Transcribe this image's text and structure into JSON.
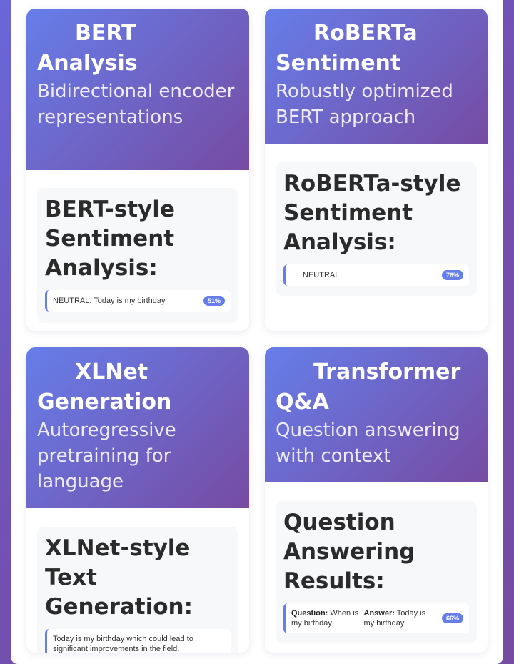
{
  "cards": [
    {
      "title": "BERT Analysis",
      "subtitle": "Bidirectional encoder representations",
      "result_title": "BERT-style Sentiment Analysis:",
      "result_text": "NEUTRAL: Today is my birthday",
      "badge": "51%"
    },
    {
      "title": "RoBERTa Sentiment",
      "subtitle": "Robustly optimized BERT approach",
      "result_title": "RoBERTa-style Sentiment Analysis:",
      "result_text": "NEUTRAL",
      "badge": "76%"
    },
    {
      "title": "XLNet Generation",
      "subtitle": "Autoregressive pretraining for language",
      "result_title": "XLNet-style Text Generation:",
      "result_text": "Today is my birthday  which could lead to significant improvements in the field."
    },
    {
      "title": "Transformer Q&A",
      "subtitle": "Question answering with context",
      "result_title": "Question Answering Results:",
      "question_label": "Question:",
      "question_text": "When is my birthday",
      "answer_label": "Answer:",
      "answer_text": "Today is my birthday",
      "badge": "66%"
    }
  ]
}
